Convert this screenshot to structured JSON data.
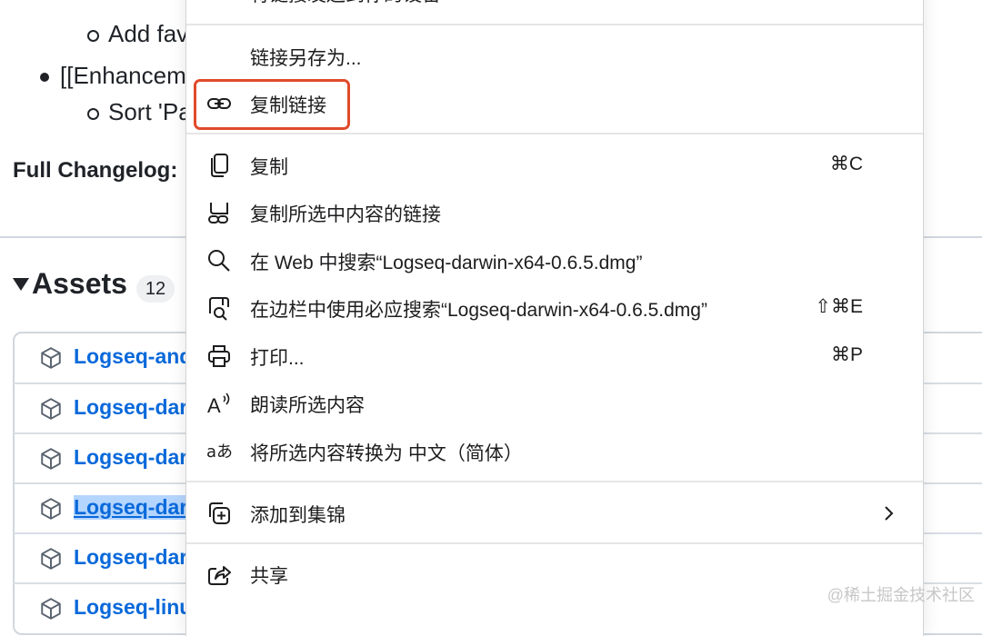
{
  "background": {
    "list_items": [
      {
        "text": "Add fav"
      },
      {
        "text": "[[Enhancem"
      },
      {
        "text": "Sort 'Pa"
      }
    ],
    "full_changelog": "Full Changelog:",
    "assets_title": "Assets",
    "assets_count": "12",
    "assets": [
      {
        "name": "Logseq-and"
      },
      {
        "name": "Logseq-dar"
      },
      {
        "name": "Logseq-dar"
      },
      {
        "name": "Logseq-dar",
        "selected": true
      },
      {
        "name": "Logseq-dar"
      },
      {
        "name": "Logseq-linu"
      }
    ]
  },
  "context_menu": {
    "top_partial": "将链接发送到你的设备",
    "items": [
      {
        "label": "链接另存为...",
        "icon": "none"
      },
      {
        "label": "复制链接",
        "icon": "link-icon",
        "highlighted": true
      },
      {
        "label": "复制",
        "icon": "copy-icon",
        "shortcut": "⌘C"
      },
      {
        "label": "复制所选中内容的链接",
        "icon": "copy-link-to-highlight-icon"
      },
      {
        "label": "在 Web 中搜索“Logseq-darwin-x64-0.6.5.dmg”",
        "icon": "search-icon"
      },
      {
        "label": "在边栏中使用必应搜索“Logseq-darwin-x64-0.6.5.dmg”",
        "icon": "sidebar-search-icon",
        "shortcut": "⇧⌘E"
      },
      {
        "label": "打印...",
        "icon": "printer-icon",
        "shortcut": "⌘P"
      },
      {
        "label": "朗读所选内容",
        "icon": "read-aloud-icon"
      },
      {
        "label": "将所选内容转换为 中文（简体）",
        "icon": "translate-icon"
      },
      {
        "label": "添加到集锦",
        "icon": "add-to-collections-icon",
        "submenu": true
      },
      {
        "label": "共享",
        "icon": "share-icon"
      }
    ],
    "read_aloud_glyph": "A",
    "translate_glyph": "aあ"
  },
  "watermark": "@稀土掘金技术社区",
  "colors": {
    "link_blue": "#0969da",
    "highlight_border": "#e14a2c",
    "selection": "#b4d5fe"
  }
}
